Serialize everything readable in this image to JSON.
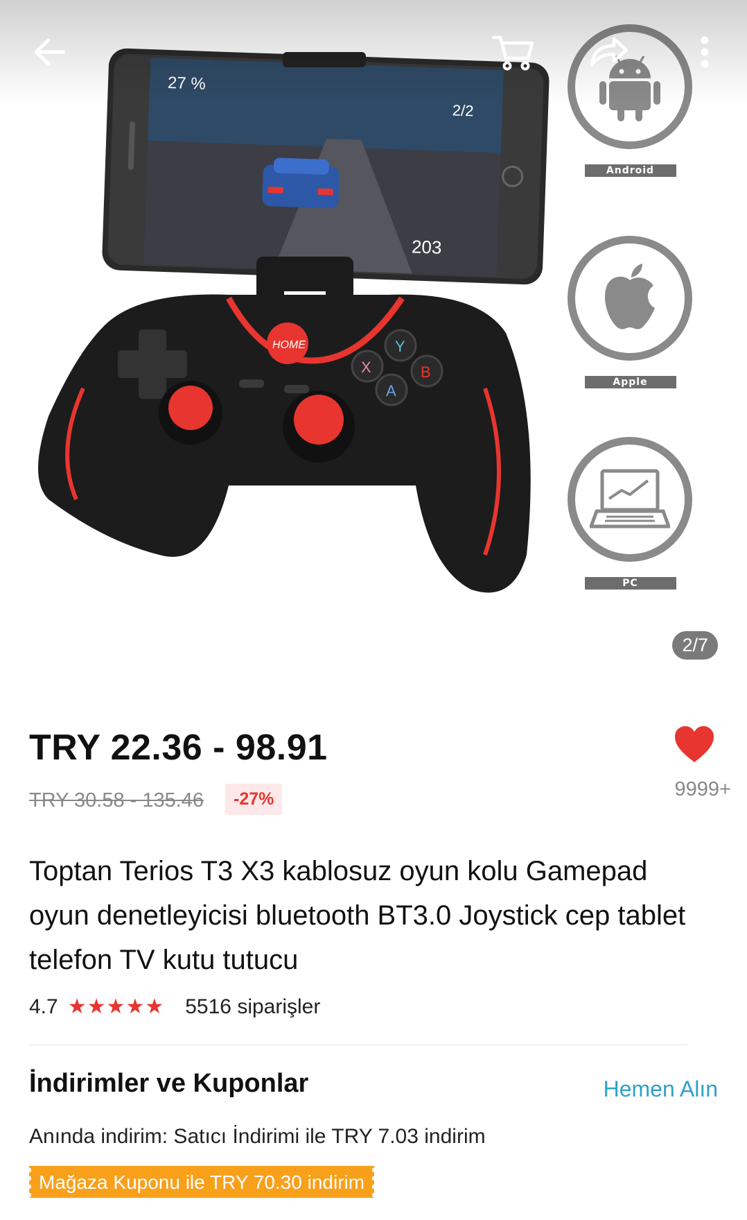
{
  "gallery": {
    "counter": "2/7",
    "os_labels": [
      "Android",
      "Apple",
      "PC"
    ]
  },
  "price": {
    "current": "TRY 22.36 - 98.91",
    "original": "TRY 30.58 - 135.46",
    "discount": "-27%"
  },
  "wishlist": {
    "count": "9999+"
  },
  "product": {
    "title": "Toptan Terios T3 X3 kablosuz oyun kolu Gamepad oyun denetleyicisi bluetooth BT3.0 Joystick cep tablet telefon TV kutu tutucu",
    "rating": "4.7",
    "rating_stars": 5,
    "orders": "5516 siparişler"
  },
  "discounts": {
    "title": "İndirimler ve Kuponlar",
    "link": "Hemen Alın",
    "instant": "Anında indirim: Satıcı İndirimi ile TRY 7.03 indirim",
    "coupon": "Mağaza Kuponu ile TRY 70.30 indirim"
  },
  "icons": [
    "back-arrow-icon",
    "cart-icon",
    "share-icon",
    "more-vertical-icon",
    "heart-icon",
    "star-icon",
    "android-icon",
    "apple-icon",
    "laptop-icon"
  ],
  "colors": {
    "accent_red": "#e8352f",
    "link_blue": "#2fa1c7",
    "coupon_orange": "#f9a01b"
  }
}
